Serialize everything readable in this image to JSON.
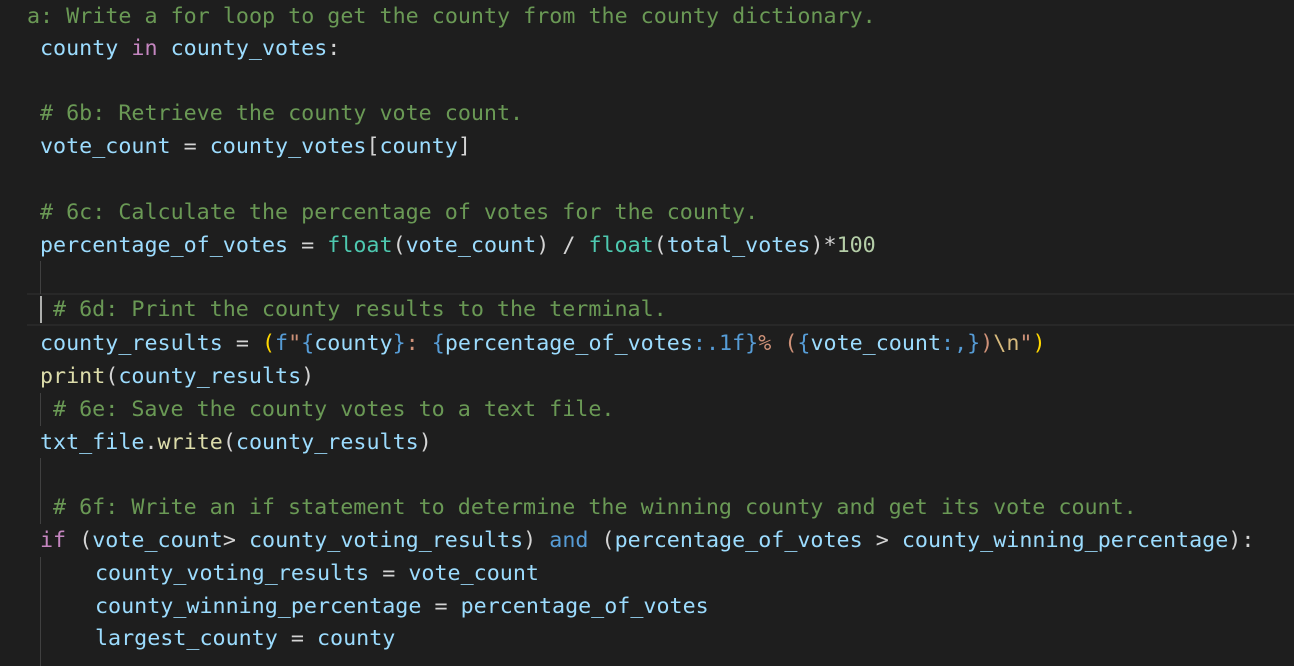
{
  "editor": {
    "language": "python",
    "theme": "dark",
    "lines": {
      "l1_comment": "a: Write a for loop to get the county from the county dictionary.",
      "l2": {
        "var": "county",
        "kw": "in",
        "iter": "county_votes",
        "colon": ":"
      },
      "l4_comment": "# 6b: Retrieve the county vote count.",
      "l5": {
        "var": "vote_count",
        "eq": " = ",
        "obj": "county_votes",
        "open": "[",
        "key": "county",
        "close": "]"
      },
      "l7_comment": "# 6c: Calculate the percentage of votes for the county.",
      "l8": {
        "var": "percentage_of_votes",
        "eq": " = ",
        "fn1": "float",
        "arg1": "vote_count",
        "div": " / ",
        "fn2": "float",
        "arg2": "total_votes",
        "mul": "*",
        "num": "100"
      },
      "l10_comment": "# 6d: Print the county results to the terminal.",
      "l11": {
        "var": "county_results",
        "eq": " = ",
        "fprefix": "f",
        "q1": "\"",
        "ph1": "county",
        "lit1": ": ",
        "ph2": "percentage_of_votes",
        "fmt2": ":.1f",
        "lit2": "% (",
        "ph3": "vote_count",
        "fmt3": ":,",
        "lit3": ")",
        "esc": "\\n",
        "q2": "\""
      },
      "l12": {
        "fn": "print",
        "arg": "county_results"
      },
      "l13_comment": "# 6e: Save the county votes to a text file.",
      "l14": {
        "obj": "txt_file",
        "dot": ".",
        "fn": "write",
        "arg": "county_results"
      },
      "l16_comment": "# 6f: Write an if statement to determine the winning county and get its vote count.",
      "l17": {
        "kw_if": "if",
        "a": "vote_count",
        "gt1": "> ",
        "b": "county_voting_results",
        "kw_and": "and",
        "c": "percentage_of_votes",
        "gt2": " > ",
        "d": "county_winning_percentage",
        "colon": ":"
      },
      "l18": {
        "var": "county_voting_results",
        "eq": " = ",
        "val": "vote_count"
      },
      "l19": {
        "var": "county_winning_percentage",
        "eq": " = ",
        "val": "percentage_of_votes"
      },
      "l20": {
        "var": "largest_county",
        "eq": " = ",
        "val": "county"
      }
    }
  }
}
